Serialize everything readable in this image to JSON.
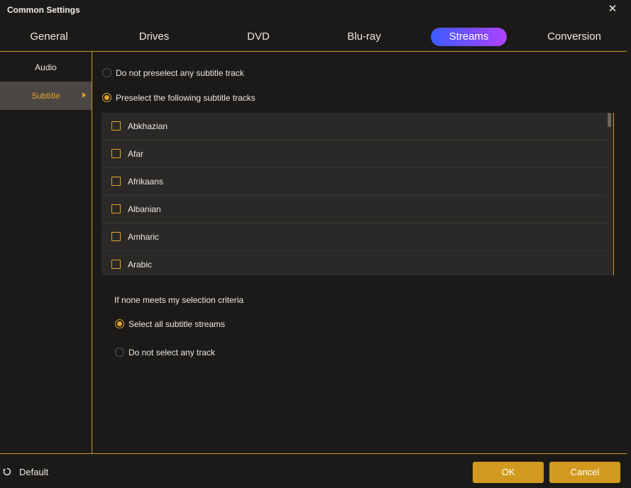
{
  "window": {
    "title": "Common Settings",
    "close_icon": "close-icon"
  },
  "tabs": [
    {
      "label": "General"
    },
    {
      "label": "Drives"
    },
    {
      "label": "DVD"
    },
    {
      "label": "Blu-ray"
    },
    {
      "label": "Streams",
      "active": true
    },
    {
      "label": "Conversion"
    }
  ],
  "sidebar": {
    "items": [
      {
        "label": "Audio"
      },
      {
        "label": "Subtitle",
        "active": true
      }
    ]
  },
  "subtitle": {
    "option_none": "Do not preselect any subtitle track",
    "option_preselect": "Preselect the following subtitle tracks",
    "selected_option": "preselect",
    "tracks": [
      {
        "label": "Abkhazian",
        "checked": false
      },
      {
        "label": "Afar",
        "checked": false
      },
      {
        "label": "Afrikaans",
        "checked": false
      },
      {
        "label": "Albanian",
        "checked": false
      },
      {
        "label": "Amharic",
        "checked": false
      },
      {
        "label": "Arabic",
        "checked": false
      }
    ],
    "criteria_label": "If none meets my selection criteria",
    "fallback_all": "Select all subtitle streams",
    "fallback_none": "Do not select any track",
    "selected_fallback": "all"
  },
  "footer": {
    "default_label": "Default",
    "default_icon": "reset-icon",
    "ok_label": "OK",
    "cancel_label": "Cancel"
  },
  "colors": {
    "accent": "#e1a52a",
    "button": "#d19a1f",
    "tab_gradient_start": "#3b5bff",
    "tab_gradient_end": "#b042ff",
    "background": "#1c1a19",
    "list_background": "#2b2927"
  }
}
